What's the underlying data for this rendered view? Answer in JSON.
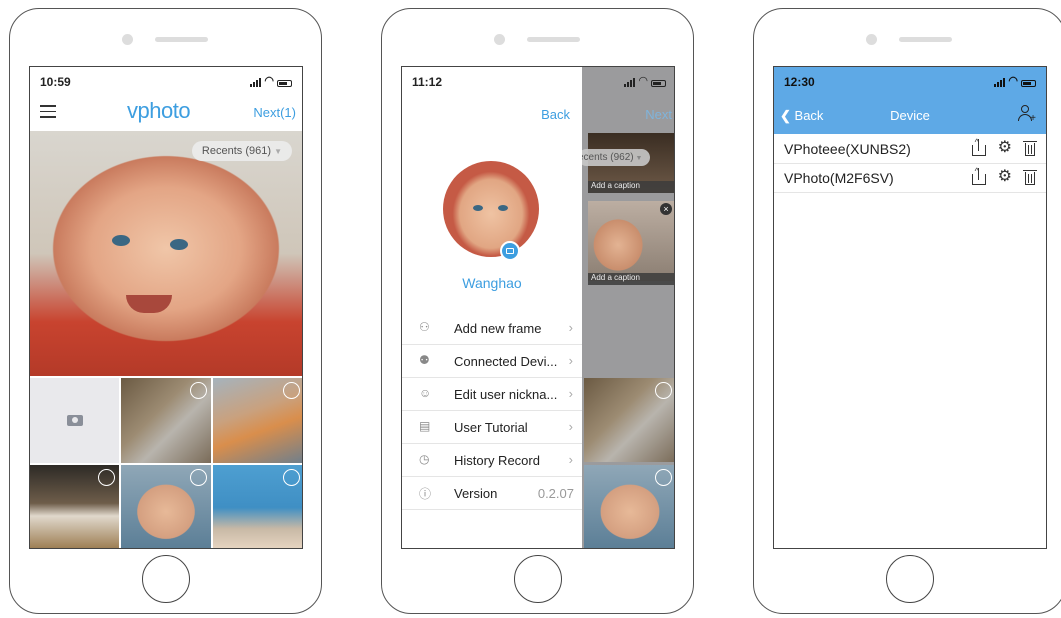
{
  "phone1": {
    "time": "10:59",
    "logo": "vphoto",
    "next_label": "Next(1)",
    "album_label": "Recents (961)",
    "icons": [
      "hamburger-icon",
      "camera-icon",
      "select-circle-icon"
    ]
  },
  "phone2": {
    "time": "11:12",
    "back_label": "Back",
    "next_label": "Next",
    "username": "Wanghao",
    "album_label": "ecents (962)",
    "caption_placeholder": "Add a caption",
    "menu": [
      {
        "label": "Add new frame",
        "icon": "add-user-icon"
      },
      {
        "label": "Connected Devi...",
        "icon": "users-icon"
      },
      {
        "label": "Edit user nickna...",
        "icon": "user-icon"
      },
      {
        "label": "User Tutorial",
        "icon": "document-icon"
      },
      {
        "label": "History Record",
        "icon": "clock-icon"
      },
      {
        "label": "Version",
        "icon": "info-icon",
        "value": "0.2.07"
      }
    ]
  },
  "phone3": {
    "time": "12:30",
    "back_label": "Back",
    "title": "Device",
    "devices": [
      {
        "name": "VPhoteee(XUNBS2)"
      },
      {
        "name": "VPhoto(M2F6SV)"
      }
    ],
    "icons": [
      "share-icon",
      "settings-icon",
      "trash-icon",
      "add-user-icon"
    ]
  },
  "colors": {
    "accent": "#3d9ee0",
    "nav_bar": "#5ea9e6"
  }
}
